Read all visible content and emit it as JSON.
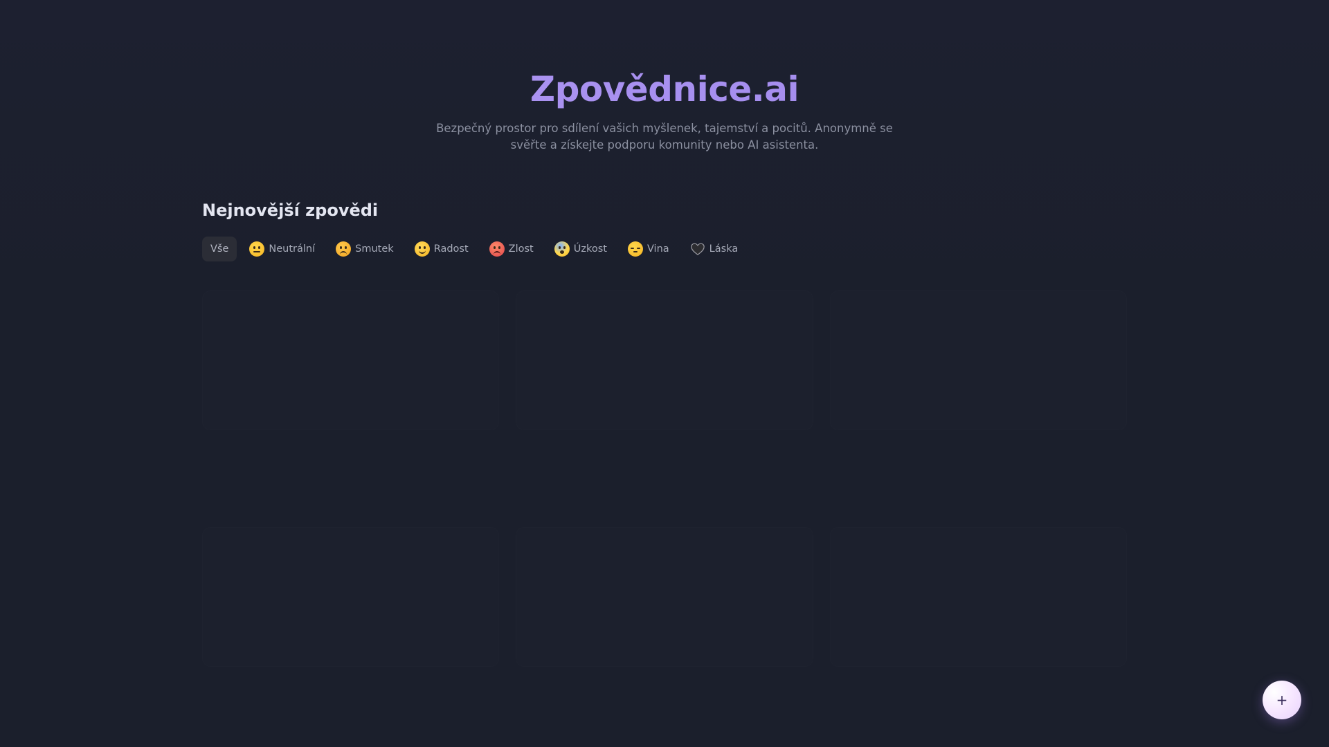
{
  "app": {
    "title": "Zpovědnice.ai",
    "tagline": "Bezpečný prostor pro sdílení vašich myšlenek, tajemství a pocitů. Anonymně se svěřte a získejte podporu komunity nebo AI asistenta."
  },
  "section": {
    "title": "Nejnovější zpovědi"
  },
  "filters": [
    {
      "label": "Vše",
      "icon": null,
      "active": true
    },
    {
      "label": "Neutrální",
      "icon": "neutral-face-icon",
      "active": false
    },
    {
      "label": "Smutek",
      "icon": "sad-face-icon",
      "active": false
    },
    {
      "label": "Radost",
      "icon": "happy-face-icon",
      "active": false
    },
    {
      "label": "Zlost",
      "icon": "angry-face-icon",
      "active": false
    },
    {
      "label": "Úzkost",
      "icon": "anxious-face-icon",
      "active": false
    },
    {
      "label": "Vina",
      "icon": "pensive-face-icon",
      "active": false
    },
    {
      "label": "Láska",
      "icon": "black-heart-icon",
      "active": false
    }
  ],
  "fab": {
    "label": "+"
  },
  "colors": {
    "background": "#1b1f2c",
    "accent": "#a990ee",
    "chip_active": "#2b2d36"
  }
}
